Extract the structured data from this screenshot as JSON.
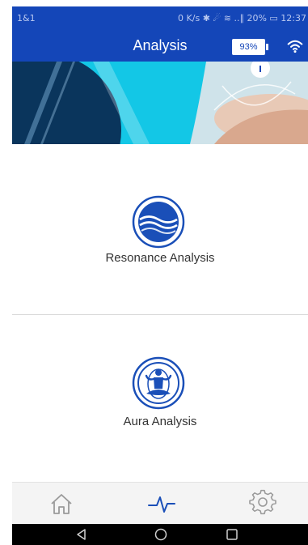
{
  "status_bar": {
    "carrier": "1&1",
    "right_text": "0 K/s ✱ ☄ ≋ ..∥ 20% ▭ 12:37"
  },
  "app_bar": {
    "title": "Analysis",
    "battery_percent": "93%",
    "wifi_icon": "wifi-icon"
  },
  "banner": {
    "image": "hand-light-banner"
  },
  "cards": [
    {
      "label": "Resonance Analysis",
      "icon": "resonance-wave-icon"
    },
    {
      "label": "Aura Analysis",
      "icon": "aura-meditation-icon"
    }
  ],
  "bottom_nav": {
    "items": [
      {
        "name": "home",
        "icon": "home-icon",
        "active": false
      },
      {
        "name": "analysis",
        "icon": "pulse-icon",
        "active": true
      },
      {
        "name": "settings",
        "icon": "gear-icon",
        "active": false
      }
    ]
  },
  "system_nav": {
    "buttons": [
      "back-icon",
      "home-circle-icon",
      "recent-apps-icon"
    ]
  },
  "colors": {
    "primary": "#1446b8",
    "icon_blue": "#1a4fb8",
    "nav_inactive": "#9a9a9a",
    "banner_dark": "#0b3b63",
    "banner_cyan": "#13c7e6"
  }
}
